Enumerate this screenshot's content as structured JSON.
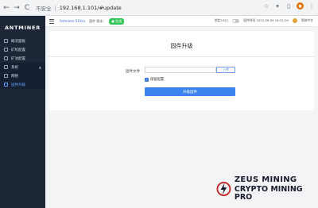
{
  "browser": {
    "back": "←",
    "forward": "→",
    "reload": "C",
    "security_text": "不安全",
    "url": "192.168.1.101/#update"
  },
  "sidebar": {
    "logo": "ANTMINER",
    "items": [
      {
        "label": "概况面板"
      },
      {
        "label": "矿机配置"
      },
      {
        "label": "矿池配置"
      },
      {
        "label": "系统"
      },
      {
        "label": "网络"
      },
      {
        "label": "固件升级"
      }
    ]
  },
  "topbar": {
    "model": "Antminer S19xx",
    "firmware": "固件 版本：",
    "badge": "● 在线",
    "lock_text": "锁定2022",
    "datetime": "固件时间 2022-08-06 18:32:26",
    "user": "简体中文"
  },
  "card": {
    "title": "固件升级",
    "file_label": "固件文件",
    "file_button": "上传",
    "keep_settings": "保留配置",
    "upgrade_button": "升级固件"
  },
  "watermark": {
    "line1": "ZEUS MINING",
    "line2": "CRYPTO MINING PRO"
  },
  "colors": {
    "sidebar_bg": "#1d2637",
    "accent": "#3b82ec",
    "active_item": "#5ea7ff"
  }
}
